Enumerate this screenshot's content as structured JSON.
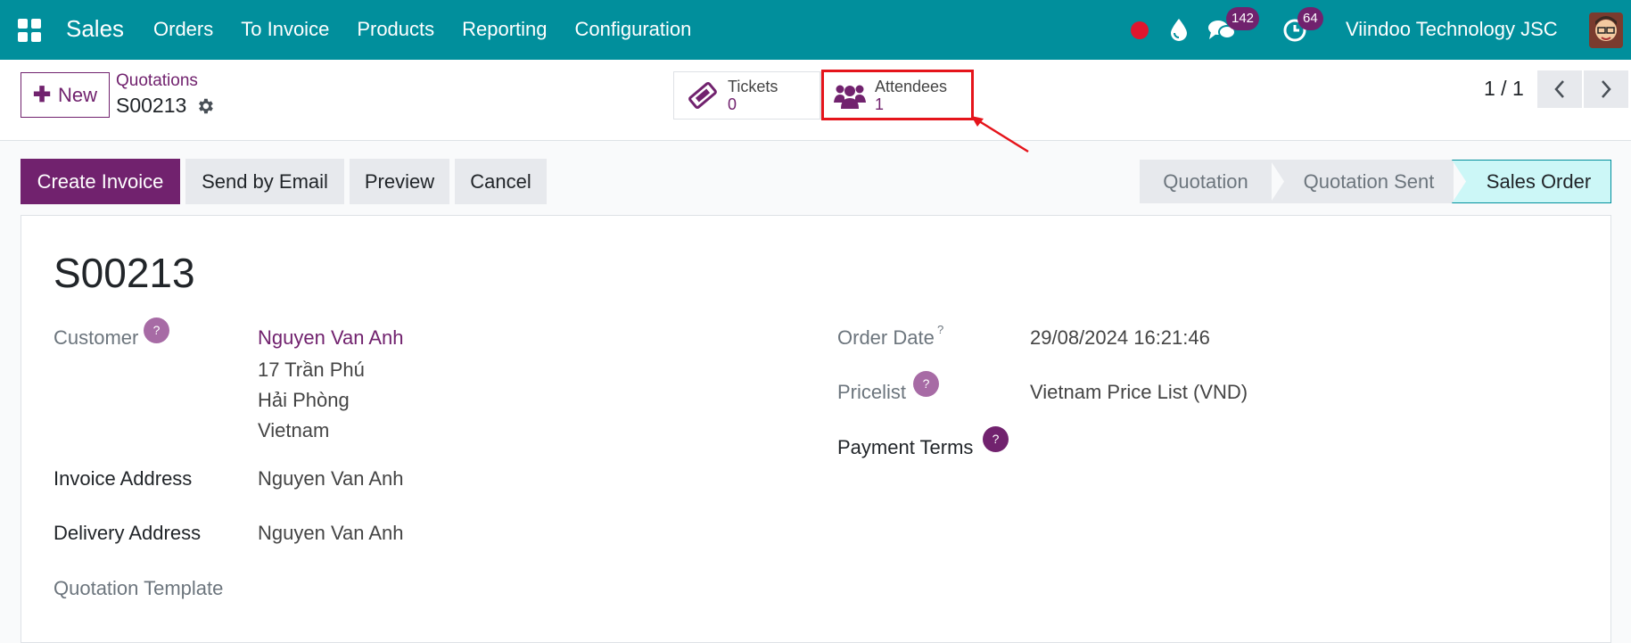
{
  "navbar": {
    "app_name": "Sales",
    "menu": [
      "Orders",
      "To Invoice",
      "Products",
      "Reporting",
      "Configuration"
    ],
    "chat_count": "142",
    "activity_count": "64",
    "company": "Viindoo Technology JSC"
  },
  "control": {
    "new_label": "New",
    "breadcrumb_parent": "Quotations",
    "breadcrumb_current": "S00213",
    "tickets": {
      "label": "Tickets",
      "value": "0"
    },
    "attendees": {
      "label": "Attendees",
      "value": "1"
    },
    "pager": "1 / 1"
  },
  "actions": {
    "create_invoice": "Create Invoice",
    "send_email": "Send by Email",
    "preview": "Preview",
    "cancel": "Cancel"
  },
  "stages": [
    "Quotation",
    "Quotation Sent",
    "Sales Order"
  ],
  "form": {
    "title": "S00213",
    "customer_label": "Customer",
    "customer_name": "Nguyen Van Anh",
    "customer_address": [
      "17 Trần Phú",
      "Hải Phòng",
      "Vietnam"
    ],
    "invoice_address_label": "Invoice Address",
    "invoice_address": "Nguyen Van Anh",
    "delivery_address_label": "Delivery Address",
    "delivery_address": "Nguyen Van Anh",
    "quotation_template_label": "Quotation Template",
    "order_date_label": "Order Date",
    "order_date": "29/08/2024 16:21:46",
    "pricelist_label": "Pricelist",
    "pricelist": "Vietnam Price List (VND)",
    "payment_terms_label": "Payment Terms",
    "help_mark": "?"
  },
  "colors": {
    "navbar": "#018f9c",
    "primary": "#71226e",
    "highlight": "#e5141b"
  }
}
